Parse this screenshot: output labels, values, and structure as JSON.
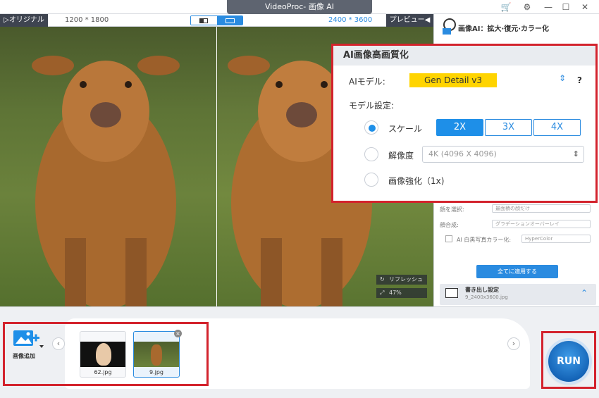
{
  "window": {
    "title": "VideoProc- 画像 AI"
  },
  "titlebar_icons": [
    "cart-icon",
    "gear-icon",
    "minimize-icon",
    "maximize-icon",
    "close-icon"
  ],
  "viewbar": {
    "original_tab": "▷オリジナル",
    "dim_left": "1200 * 1800",
    "dim_right": "2400 * 3600",
    "preview_btn": "プレビュー◀"
  },
  "overlay": {
    "refresh": "リフレッシュ",
    "zoom": "47%"
  },
  "right_panel": {
    "title": "画像AI：拡大·復元·カラー化",
    "rows": [
      {
        "label": "顔を選択:",
        "value": "最面積の顔だけ"
      },
      {
        "label": "顔合成:",
        "value": "グラデーションオーバーレイ"
      },
      {
        "label": "AI 白黒写真カラー化:",
        "value": "HyperColor"
      }
    ],
    "apply_all": "全てに適用する",
    "export_title": "書き出し設定",
    "export_file": "9_2400x3600.jpg"
  },
  "popup": {
    "heading": "AI画像高画質化",
    "model_label": "AIモデル:",
    "model_value": "Gen Detail v3",
    "help": "?",
    "settings_label": "モデル設定:",
    "scale_label": "スケール",
    "scale_options": [
      "2X",
      "3X",
      "4X"
    ],
    "scale_selected": "2X",
    "resolution_label": "解像度",
    "resolution_value": "4K (4096 X 4096)",
    "enhance_label": "画像強化（1x)"
  },
  "bottom": {
    "add_label": "画像追加",
    "thumbs": [
      {
        "name": "62.jpg"
      },
      {
        "name": "9.jpg"
      }
    ],
    "run": "RUN"
  },
  "colors": {
    "accent": "#1e8fe8",
    "highlight": "#d3232d",
    "model_bg": "#ffd400"
  }
}
